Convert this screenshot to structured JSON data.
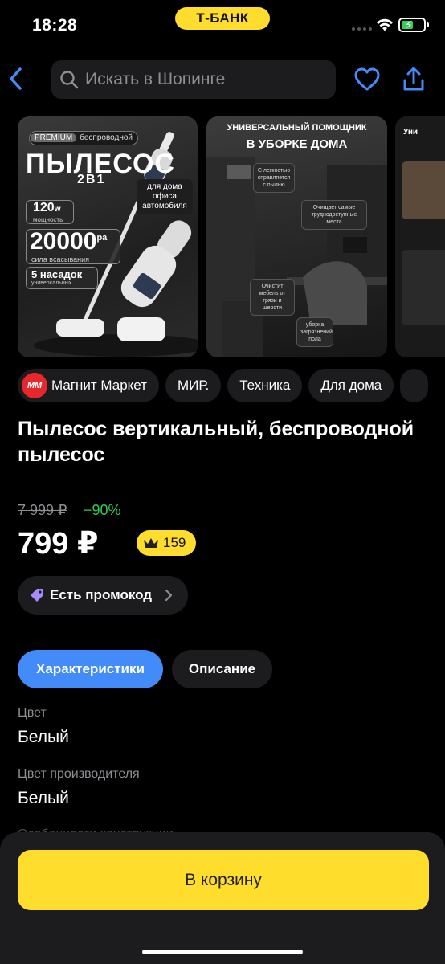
{
  "status_bar": {
    "time": "18:28",
    "bank_label": "Т-БАНК"
  },
  "header": {
    "search_placeholder": "Искать в Шопинге"
  },
  "gallery": {
    "card1": {
      "badge_premium": "PREMIUM",
      "badge_text": "беспроводной",
      "title": "ПЫЛЕСОС",
      "subtitle": "2В1",
      "uses": "для дома офиса автомобиля",
      "power_value": "120",
      "power_unit": "w",
      "power_label": "мощность",
      "suction_value": "20000",
      "suction_unit": "pa",
      "suction_label": "сила всасывания",
      "nozzles_value": "5 насадок",
      "nozzles_label": "универсальных"
    },
    "card2": {
      "title_top": "УНИВЕРСАЛЬНЫЙ ПОМОЩНИК",
      "title_bottom": "В УБОРКЕ ДОМА",
      "note1": "С легкостью справляется с пылью",
      "note2": "Очищает самые труднодоступные места",
      "note3": "Очистит мебель от грязи и шерсти",
      "note4": "уборка загрязнений пола"
    },
    "card3": {
      "title": "Уни"
    }
  },
  "tags": {
    "store": "Магнит Маркет",
    "store_logo": "ММ",
    "mir": "МИР.",
    "category": "Техника",
    "home": "Для дома"
  },
  "product": {
    "title": "Пылесос вертикальный, беспроводной пылесос",
    "old_price": "7 999 ₽",
    "discount": "−90%",
    "price": "799 ₽",
    "cashback": "159"
  },
  "promo": {
    "label": "Есть промокод"
  },
  "tabs": {
    "specs": "Характеристики",
    "description": "Описание"
  },
  "specs": [
    {
      "label": "Цвет",
      "value": "Белый"
    },
    {
      "label": "Цвет производителя",
      "value": "Белый"
    },
    {
      "label": "Особенности конструкции"
    }
  ],
  "cart": {
    "button_label": "В корзину"
  },
  "colors": {
    "accent_yellow": "#ffdd2d",
    "active_tab_blue": "#428bf9",
    "discount_green": "#34c759"
  }
}
